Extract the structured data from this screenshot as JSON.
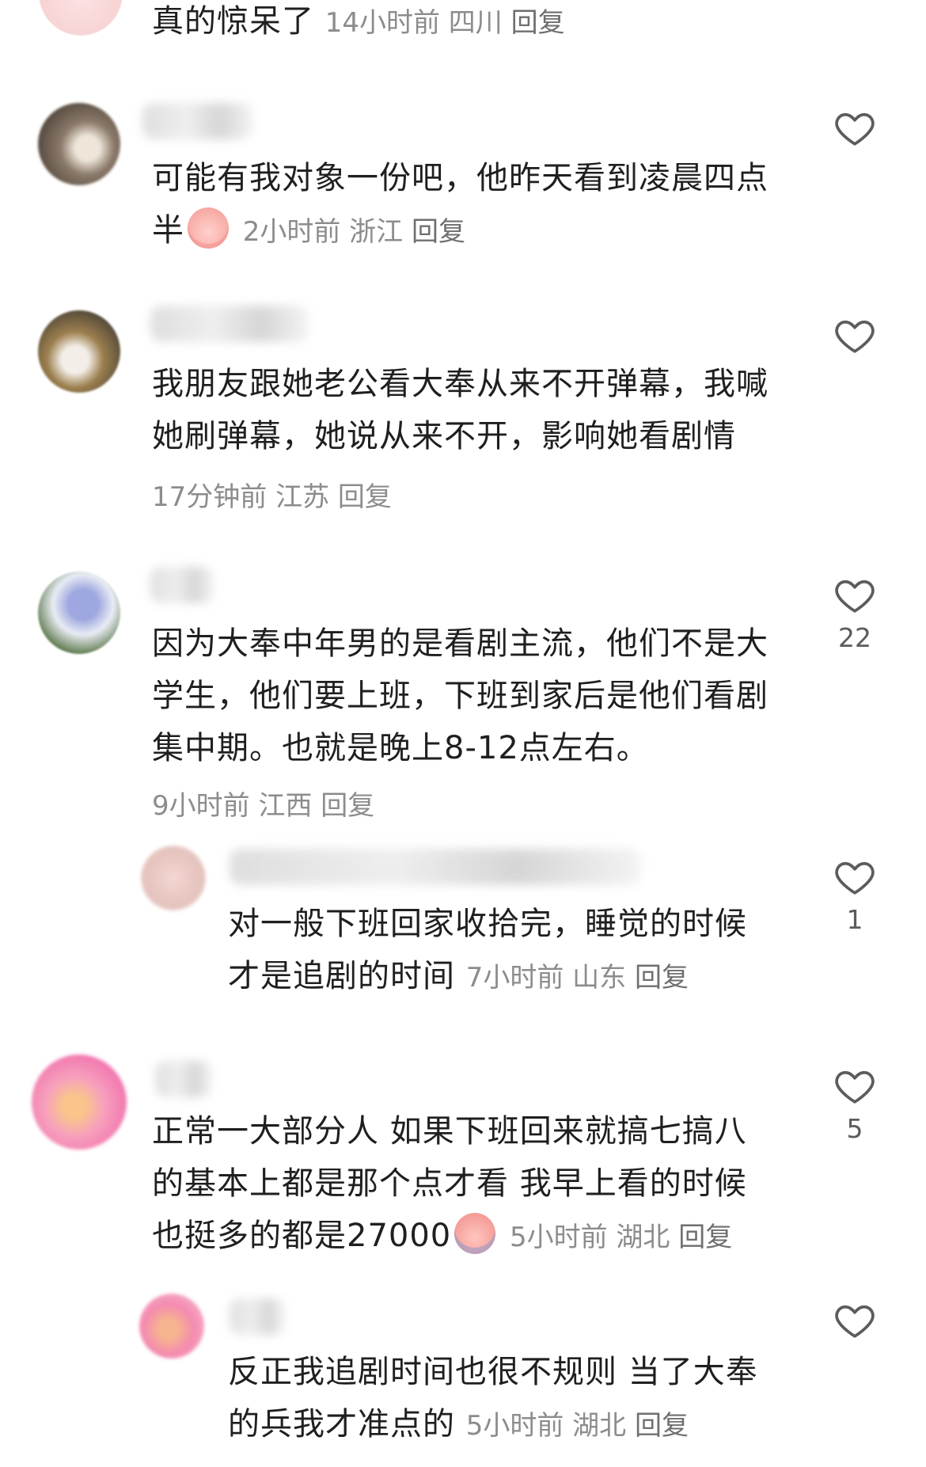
{
  "comments": [
    {
      "text": "真的惊呆了",
      "time": "14小时前",
      "location": "四川",
      "reply": "回复"
    },
    {
      "text": "可能有我对象一份吧，他昨天看到凌晨四点半",
      "time": "2小时前",
      "location": "浙江",
      "reply": "回复",
      "emoji": "peach-face-emoji"
    },
    {
      "text_l1": "我朋友跟她老公看大奉从来不开弹幕，我喊",
      "text_l2": "她刷弹幕，她说从来不开，影响她看剧情",
      "time": "17分钟前",
      "location": "江苏",
      "reply": "回复"
    },
    {
      "text_l1": "因为大奉中年男的是看剧主流，他们不是大",
      "text_l2": "学生，他们要上班，下班到家后是他们看剧",
      "text_l3": "集中期。也就是晚上8-12点左右。",
      "time": "9小时前",
      "location": "江西",
      "reply": "回复",
      "likes": "22"
    },
    {
      "text_l1": "对一般下班回家收拾完，睡觉的时候",
      "text_l2": "才是追剧的时间",
      "time": "7小时前",
      "location": "山东",
      "reply": "回复",
      "likes": "1"
    },
    {
      "text_l1": "正常一大部分人 如果下班回来就搞七搞八",
      "text_l2": "的基本上都是那个点才看 我早上看的时候",
      "text_l3": "也挺多的都是27000",
      "time": "5小时前",
      "location": "湖北",
      "reply": "回复",
      "likes": "5",
      "emoji": "crying-peach-emoji"
    },
    {
      "text_l1": "反正我追剧时间也很不规则 当了大奉",
      "text_l2": "的兵我才准点的",
      "time": "5小时前",
      "location": "湖北",
      "reply": "回复"
    }
  ],
  "icons": {
    "like": "heart-outline-icon"
  },
  "colors": {
    "text": "#1f1f1f",
    "meta": "#8c8c8c",
    "icon": "#5c5c5c"
  }
}
